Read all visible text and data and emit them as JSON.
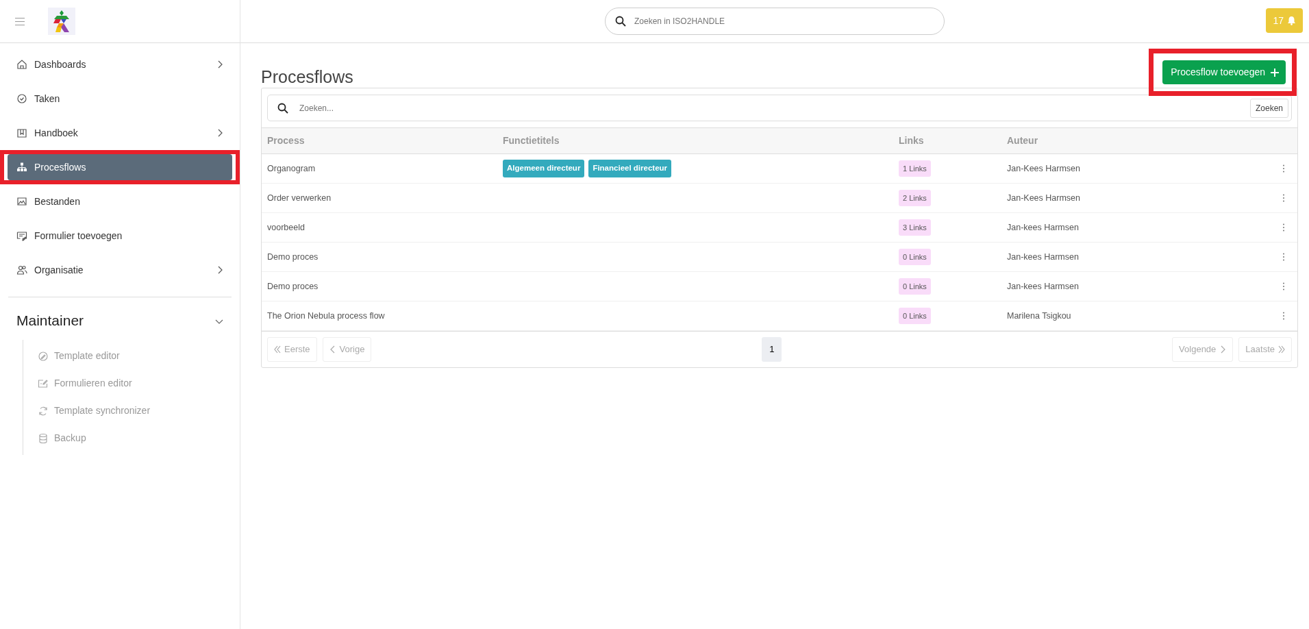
{
  "header": {
    "search": {
      "placeholder": "Zoeken in ISO2HANDLE"
    },
    "notifications": "17"
  },
  "sidebar": {
    "items": [
      {
        "label": "Dashboards",
        "expandable": true,
        "selected": false,
        "highlighted": false
      },
      {
        "label": "Taken",
        "expandable": false,
        "selected": false,
        "highlighted": false
      },
      {
        "label": "Handboek",
        "expandable": true,
        "selected": false,
        "highlighted": false
      },
      {
        "label": "Procesflows",
        "expandable": false,
        "selected": true,
        "highlighted": true
      },
      {
        "label": "Bestanden",
        "expandable": false,
        "selected": false,
        "highlighted": false
      },
      {
        "label": "Formulier toevoegen",
        "expandable": false,
        "selected": false,
        "highlighted": false
      },
      {
        "label": "Organisatie",
        "expandable": true,
        "selected": false,
        "highlighted": false
      }
    ],
    "section": {
      "title": "Maintainer",
      "expanded": true,
      "items": [
        "Template editor",
        "Formulieren editor",
        "Template synchronizer",
        "Backup"
      ]
    }
  },
  "page": {
    "title": "Procesflows",
    "add_button": {
      "label": "Procesflow toevoegen",
      "highlighted": true
    }
  },
  "search": {
    "placeholder": "Zoeken...",
    "button": "Zoeken"
  },
  "table": {
    "columns": [
      "Process",
      "Functietitels",
      "Links",
      "Auteur"
    ],
    "rows": [
      {
        "process": "Organogram",
        "functions": [
          "Algemeen directeur",
          "Financieel directeur"
        ],
        "links": "1 Links",
        "author": "Jan-Kees Harmsen"
      },
      {
        "process": "Order verwerken",
        "functions": [],
        "links": "2 Links",
        "author": "Jan-Kees Harmsen"
      },
      {
        "process": "voorbeeld",
        "functions": [],
        "links": "3 Links",
        "author": "Jan-kees Harmsen"
      },
      {
        "process": "Demo proces",
        "functions": [],
        "links": "0 Links",
        "author": "Jan-kees Harmsen"
      },
      {
        "process": "Demo proces",
        "functions": [],
        "links": "0 Links",
        "author": "Jan-kees Harmsen"
      },
      {
        "process": "The Orion Nebula process flow",
        "functions": [],
        "links": "0 Links",
        "author": "Marilena Tsigkou"
      }
    ]
  },
  "pagination": {
    "first": {
      "label": "Eerste",
      "disabled": true
    },
    "prev": {
      "label": "Vorige",
      "disabled": true
    },
    "pages": [
      {
        "label": "1",
        "selected": true
      }
    ],
    "next": {
      "label": "Volgende",
      "disabled": true
    },
    "last": {
      "label": "Laatste",
      "disabled": true
    }
  }
}
